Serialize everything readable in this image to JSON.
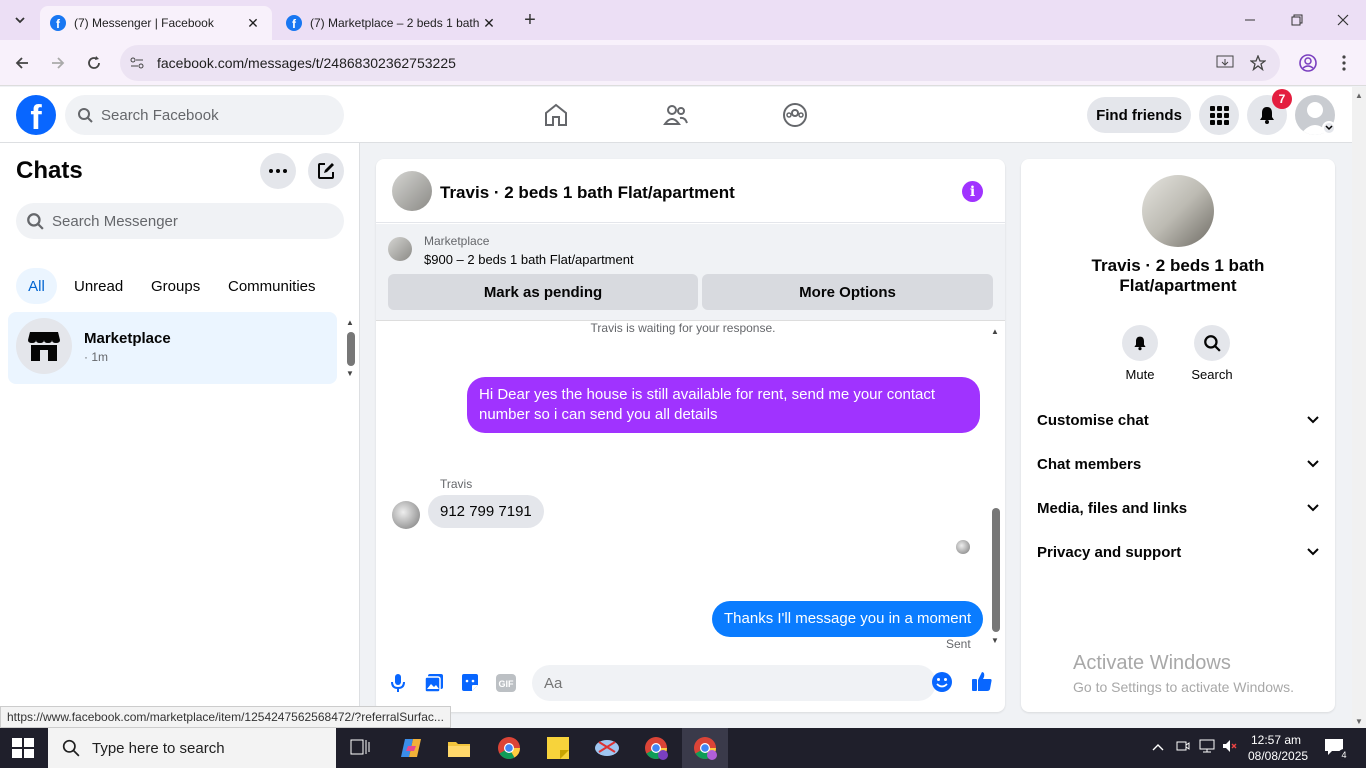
{
  "browser": {
    "tabs": [
      {
        "title": "(7) Messenger | Facebook"
      },
      {
        "title": "(7) Marketplace – 2 beds 1 bath"
      }
    ],
    "url": "facebook.com/messages/t/24868302362753225",
    "status_url": "https://www.facebook.com/marketplace/item/1254247562568472/?referralSurfac..."
  },
  "fb": {
    "search_placeholder": "Search Facebook",
    "find_friends": "Find friends",
    "notification_count": "7"
  },
  "chats": {
    "title": "Chats",
    "search_placeholder": "Search Messenger",
    "filters": [
      "All",
      "Unread",
      "Groups",
      "Communities"
    ],
    "active_filter": "All",
    "items": [
      {
        "name": "Marketplace",
        "time": "· 1m"
      }
    ]
  },
  "conversation": {
    "title": "Travis · 2 beds 1 bath Flat/apartment",
    "marketplace": {
      "label": "Marketplace",
      "listing": "$900 – 2 beds 1 bath Flat/apartment",
      "buttons": [
        "Mark as pending",
        "More Options"
      ]
    },
    "waiting_note": "Travis is waiting for your response.",
    "messages": [
      {
        "from": "me",
        "text": "Hi Dear yes the house is still available for rent, send me your contact number so i can send you all details"
      },
      {
        "from": "Travis",
        "sender_label": "Travis",
        "text": "912 799 7191"
      },
      {
        "from": "me",
        "text": "Thanks I'll message you in a moment"
      }
    ],
    "sent_label": "Sent",
    "composer_placeholder": "Aa"
  },
  "info_panel": {
    "name": "Travis · 2 beds 1 bath Flat/apartment",
    "actions": [
      "Mute",
      "Search"
    ],
    "sections": [
      "Customise chat",
      "Chat members",
      "Media, files and links",
      "Privacy and support"
    ]
  },
  "watermark": {
    "line1": "Activate Windows",
    "line2": "Go to Settings to activate Windows."
  },
  "taskbar": {
    "search_placeholder": "Type here to search",
    "time": "12:57 am",
    "date": "08/08/2025",
    "notif_count": "4"
  },
  "colors": {
    "fb_blue": "#0866ff",
    "messenger_purple": "#a033ff",
    "messenger_blue": "#0a7cff",
    "badge_red": "#e41e3f"
  }
}
